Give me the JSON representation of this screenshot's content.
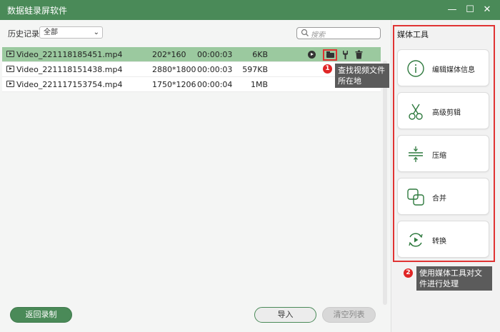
{
  "window": {
    "title": "数据蛙录屏软件",
    "controls": {
      "minimize": "—",
      "maximize": "☐",
      "close": "✕"
    }
  },
  "toolbar": {
    "history_label": "历史记录",
    "filter_value": "全部",
    "search_placeholder": "搜索"
  },
  "files": [
    {
      "name": "Video_221118185451.mp4",
      "resolution": "202*160",
      "duration": "00:00:03",
      "size": "6KB",
      "selected": true
    },
    {
      "name": "Video_221118151438.mp4",
      "resolution": "2880*1800",
      "duration": "00:00:03",
      "size": "597KB",
      "selected": false
    },
    {
      "name": "Video_221117153754.mp4",
      "resolution": "1750*1206",
      "duration": "00:00:04",
      "size": "1MB",
      "selected": false
    }
  ],
  "row_actions": [
    "play-icon",
    "folder-icon",
    "tool-icon",
    "trash-icon"
  ],
  "tips": {
    "tip1_number": "1",
    "tip1_text": "查找视频文件所在地",
    "tip2_number": "2",
    "tip2_text": "使用媒体工具对文件进行处理"
  },
  "media_tools": {
    "title": "媒体工具",
    "items": [
      {
        "label": "编辑媒体信息",
        "icon": "info-icon"
      },
      {
        "label": "高级剪辑",
        "icon": "scissors-icon"
      },
      {
        "label": "压缩",
        "icon": "compress-icon"
      },
      {
        "label": "合并",
        "icon": "merge-icon"
      },
      {
        "label": "转换",
        "icon": "convert-icon"
      }
    ]
  },
  "buttons": {
    "back": "返回录制",
    "import": "导入",
    "clear": "清空列表"
  },
  "colors": {
    "brand_green": "#4a8a58",
    "selected_row": "#9bc99f",
    "highlight_red": "#e03333",
    "tooltip_bg": "#5b5b5b"
  }
}
